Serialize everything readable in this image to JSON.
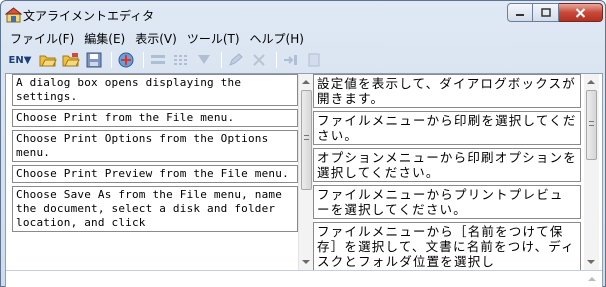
{
  "window": {
    "title": "文アライメントエディタ",
    "minimize_label": "–",
    "maximize_label": "□",
    "close_label": "✕"
  },
  "menu": [
    {
      "label": "ファイル(F)"
    },
    {
      "label": "編集(E)"
    },
    {
      "label": "表示(V)"
    },
    {
      "label": "ツール(T)"
    },
    {
      "label": "ヘルプ(H)"
    }
  ],
  "toolbar": {
    "language_toggle_label": "EN▼"
  },
  "source_segments": [
    {
      "text": "A dialog box opens displaying the settings."
    },
    {
      "text": "Choose Print from the File menu."
    },
    {
      "text": "Choose Print Options from the Options menu."
    },
    {
      "text": "Choose Print Preview from the File menu."
    },
    {
      "text": "Choose Save As from the File menu, name the document, select a disk and folder location, and click"
    }
  ],
  "target_segments": [
    {
      "text": "設定値を表示して、ダイアログボックスが開きます。"
    },
    {
      "text": "ファイルメニューから印刷を選択してください。"
    },
    {
      "text": "オプションメニューから印刷オプションを選択してください。"
    },
    {
      "text": "ファイルメニューからプリントプレビューを選択してください。"
    },
    {
      "text": "ファイルメニューから［名前をつけて保存］を選択して、文書に名前をつけ、ディスクとフォルダ位置を選択し"
    }
  ]
}
